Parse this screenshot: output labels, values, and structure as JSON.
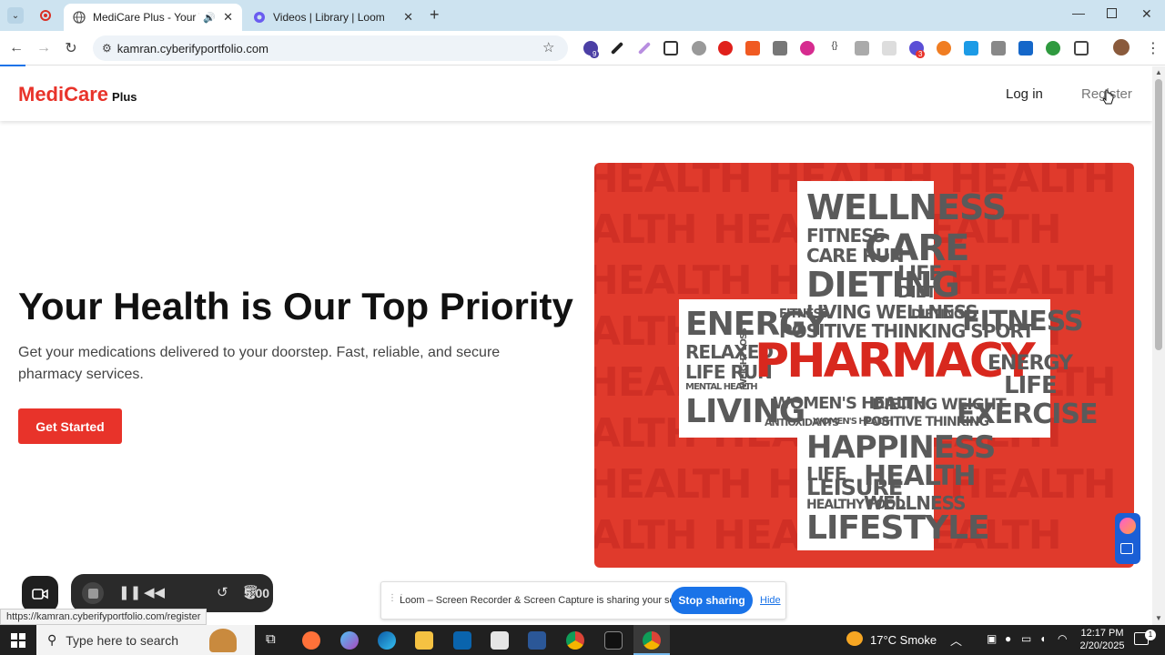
{
  "browser": {
    "tabs": [
      {
        "title": "MediCare Plus - Your Truste",
        "active": true
      },
      {
        "title": "Videos | Library | Loom",
        "active": false
      }
    ],
    "url": "kamran.cyberifyportfolio.com",
    "status_url": "https://kamran.cyberifyportfolio.com/register",
    "extension_badges": {
      "first": "9",
      "second": "3"
    }
  },
  "navbar": {
    "brand_main": "MediCare",
    "brand_sub": "Plus",
    "login_label": "Log in",
    "register_label": "Register"
  },
  "hero": {
    "title": "Your Health is Our Top Priority",
    "subtitle": "Get your medications delivered to your doorstep. Fast, reliable, and secure pharmacy services.",
    "cta_label": "Get Started"
  },
  "image_words": {
    "background": [
      "HEALTH",
      "HEALTH",
      "HEALTH",
      "HEALTH",
      "HEALTH",
      "HEALTH",
      "HEALTH",
      "HEALTH",
      "HEALTH",
      "HEALTH",
      "HEALTH",
      "HEALTH",
      "HEALTH",
      "HEALTH",
      "HEALTH",
      "HEALTH",
      "HEALTH",
      "HEALTH",
      "HEALTH",
      "HEALTH",
      "HEALTH",
      "HEALTH",
      "HEALTH",
      "HEALTH"
    ],
    "wellness": "WELLNESS",
    "fitness_small": "FITNESS",
    "care_run": "CARE RUN",
    "care": "CARE",
    "dieting": "DIETING",
    "life": "LIFE",
    "diet": "DIET",
    "living_wellness": "LIVING WELLNESS",
    "energy": "ENERGY",
    "fitness_tiny": "FITNESS",
    "positive_thinking_sport": "POSITIVE THINKING SPORT",
    "dieting_small": "DIETING",
    "fitness_big": "FITNESS",
    "relaxed": "RELAXED",
    "life_run": "LIFE RUN",
    "mental_health": "MENTAL HEALTH",
    "weight_loss": "WEIGHT LOSS",
    "pharmacy": "PHARMACY",
    "energy_right": "ENERGY",
    "life_right": "LIFE",
    "living": "LIVING",
    "womens_health": "WOMEN'S HEALTH",
    "dieting_weight": "DIETING WEIGHT",
    "antioxidants": "ANTIOXIDANTS",
    "womens_health_small": "WOMEN'S HEALTH",
    "positive_thinking": "POSITIVE THINKING",
    "exercise": "EXERCISE",
    "happiness": "HAPPINESS",
    "life_bottom": "LIFE",
    "health": "HEALTH",
    "leisure": "LEISURE",
    "healthy_food": "HEALTHY FOOD",
    "wellness_bottom": "WELLNESS",
    "lifestyle": "LIFESTYLE"
  },
  "loom": {
    "timer": "5:00",
    "share_message": "Loom – Screen Recorder & Screen Capture is sharing your screen.",
    "stop_label": "Stop sharing",
    "hide_label": "Hide"
  },
  "taskbar": {
    "search_placeholder": "Type here to search",
    "weather": "17°C  Smoke",
    "time": "12:17 PM",
    "date": "2/20/2025",
    "notification_count": "1"
  },
  "colors": {
    "brand_red": "#e8332a",
    "image_red": "#e03a2c",
    "link_blue": "#1a73e8",
    "tabbar": "#cde3f0"
  }
}
